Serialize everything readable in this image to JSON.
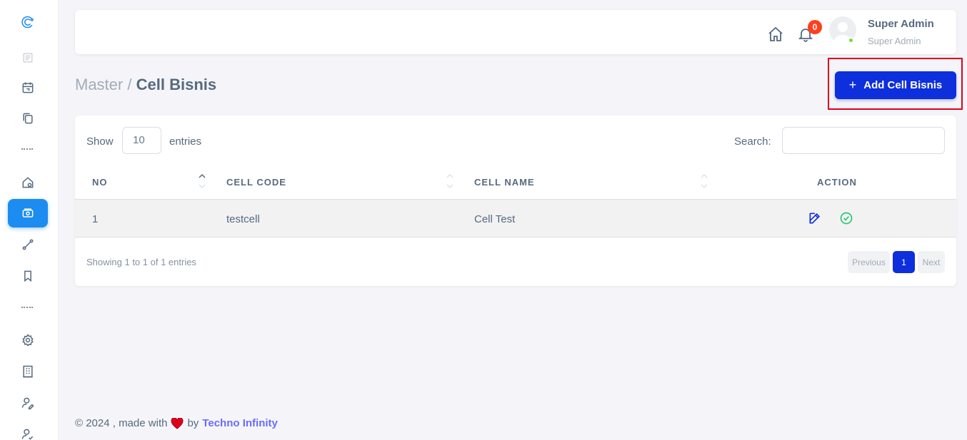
{
  "navbar": {
    "user_name": "Super Admin",
    "user_role": "Super Admin",
    "notification_count": "0"
  },
  "page": {
    "breadcrumb_parent": "Master",
    "breadcrumb_separator": "/",
    "breadcrumb_current": "Cell Bisnis",
    "add_button_label": "Add Cell Bisnis",
    "add_button_icon": "+"
  },
  "table_controls": {
    "show_label": "Show",
    "entries_value": "10",
    "entries_label": "entries",
    "search_label": "Search:",
    "search_value": ""
  },
  "table": {
    "columns": [
      "NO",
      "CELL CODE",
      "CELL NAME",
      "ACTION"
    ],
    "rows": [
      {
        "no": "1",
        "cell_code": "testcell",
        "cell_name": "Cell Test"
      }
    ]
  },
  "pagination": {
    "info": "Showing 1 to 1 of 1 entries",
    "previous": "Previous",
    "current_page": "1",
    "next": "Next"
  },
  "footer": {
    "prefix": "© 2024 , made with",
    "by": "by",
    "brand": "Techno Infinity"
  },
  "colors": {
    "primary": "#0d2fdc",
    "sidebar_active": "#1c8cf0",
    "badge": "#ff3e1d",
    "online": "#71dd37",
    "edit_icon": "#0d2fdc",
    "check_icon": "#28c76f",
    "highlight_border": "#e0001b",
    "brand_link": "#696cff"
  },
  "icons": {
    "sidebar": [
      "logo-icon",
      "document-icon",
      "calendar-icon",
      "copy-icon",
      "home-settings-icon",
      "money-icon",
      "route-icon",
      "bookmark-icon",
      "gear-icon",
      "building-icon",
      "user-edit-icon",
      "user-check-icon"
    ],
    "navbar": [
      "home-icon",
      "bell-icon",
      "avatar"
    ]
  }
}
